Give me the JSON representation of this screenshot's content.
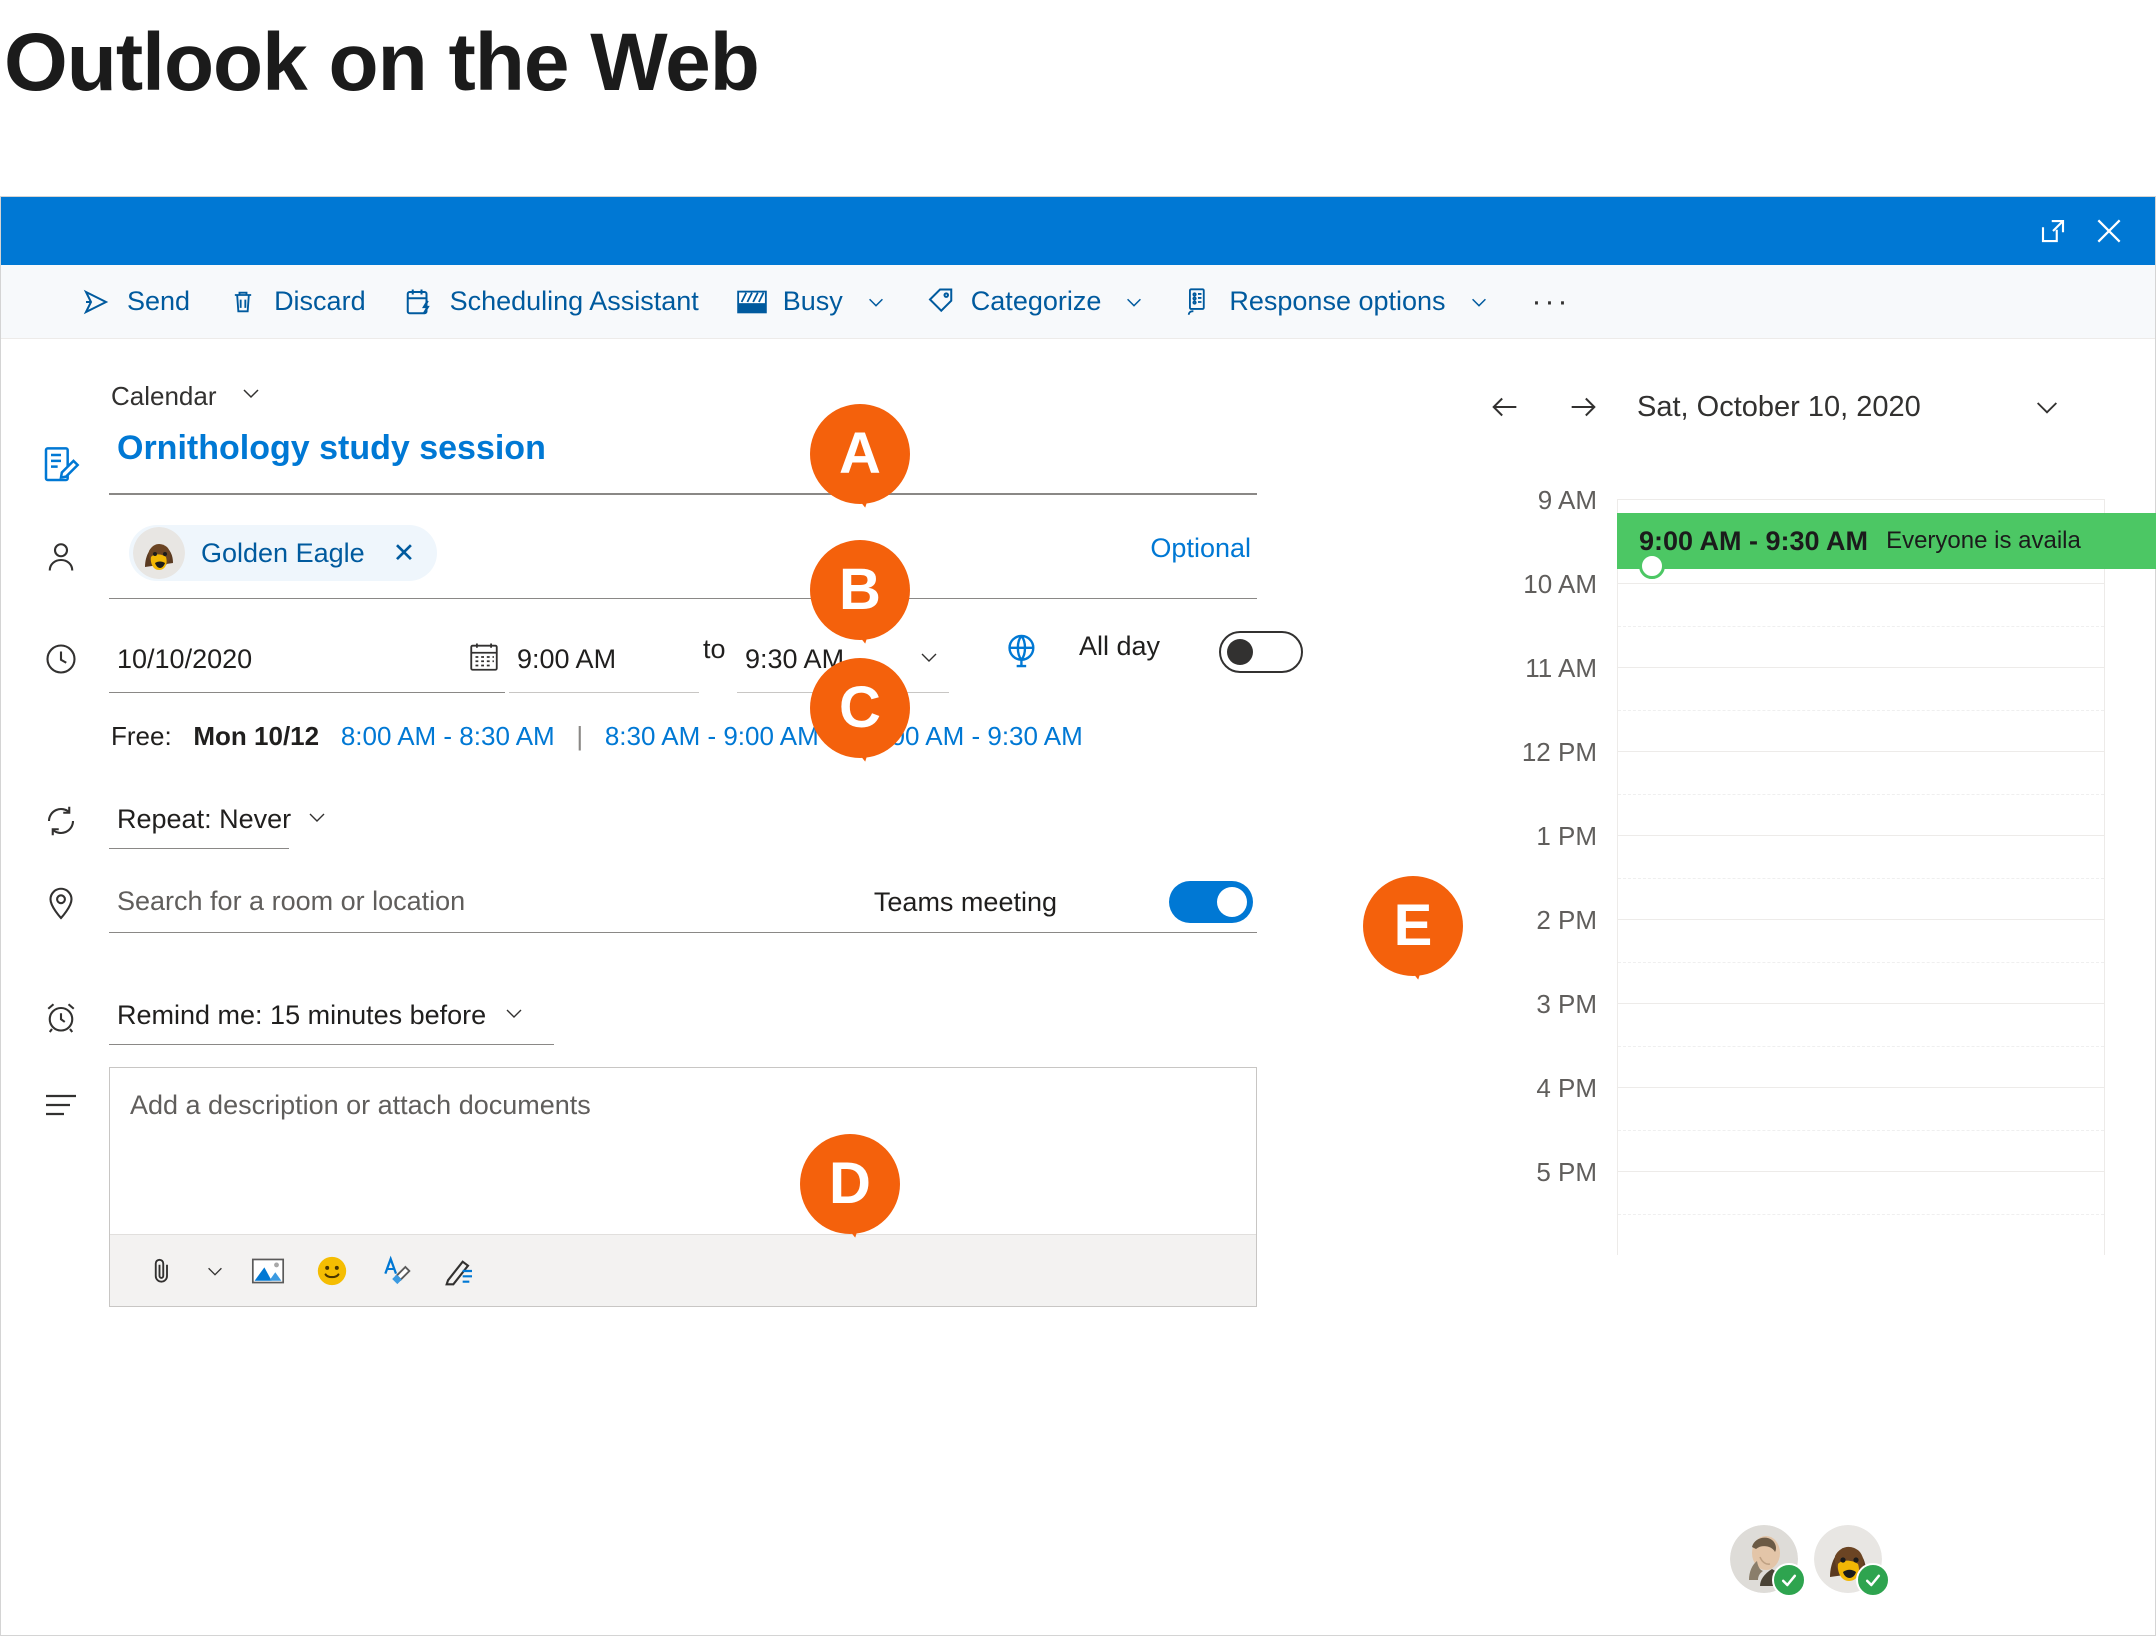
{
  "page": {
    "title": "Outlook on the Web"
  },
  "titlebar": {
    "popout_icon": "pop-out-icon",
    "close_icon": "close-icon"
  },
  "ribbon": {
    "items": [
      {
        "label": "Send",
        "icon": "send-icon",
        "caret": false
      },
      {
        "label": "Discard",
        "icon": "trash-icon",
        "caret": false
      },
      {
        "label": "Scheduling Assistant",
        "icon": "scheduling-assistant-icon",
        "caret": false
      },
      {
        "label": "Busy",
        "icon": "busy-icon",
        "caret": true
      },
      {
        "label": "Categorize",
        "icon": "tag-icon",
        "caret": true
      },
      {
        "label": "Response options",
        "icon": "response-options-icon",
        "caret": true
      }
    ],
    "overflow": "···"
  },
  "form": {
    "calendar_selector": "Calendar",
    "title_value": "Ornithology study session",
    "attendee": {
      "name": "Golden Eagle",
      "remove": "✕"
    },
    "optional_link": "Optional",
    "date_value": "10/10/2020",
    "start_time": "9:00 AM",
    "to_word": "to",
    "end_time": "9:30 AM",
    "all_day_label": "All day",
    "all_day_on": false,
    "free": {
      "label": "Free:",
      "day": "Mon 10/12",
      "slots": [
        "8:00 AM - 8:30 AM",
        "8:30 AM - 9:00 AM",
        "9:00 AM - 9:30 AM"
      ],
      "separator": "|"
    },
    "repeat": "Repeat:  Never",
    "location_placeholder": "Search for a room or location",
    "teams_label": "Teams meeting",
    "teams_on": true,
    "remind": "Remind me:  15 minutes before",
    "description_placeholder": "Add a description or attach documents",
    "description_tools": [
      "attach-icon",
      "insert-picture-icon",
      "emoji-icon",
      "font-color-icon",
      "signature-icon"
    ]
  },
  "calendar": {
    "date_header": "Sat, October 10, 2020",
    "back_icon": "arrow-left-icon",
    "forward_icon": "arrow-right-icon",
    "expand_icon": "chevron-down-icon",
    "hours": [
      "9 AM",
      "10 AM",
      "11 AM",
      "12 PM",
      "1 PM",
      "2 PM",
      "3 PM",
      "4 PM",
      "5 PM"
    ],
    "event": {
      "time": "9:00 AM - 9:30 AM",
      "note": "Everyone is availa",
      "color": "#4cc764"
    },
    "attendees": [
      {
        "name": "attendee-1",
        "status": "accepted"
      },
      {
        "name": "attendee-2",
        "status": "accepted"
      }
    ]
  },
  "callouts": [
    {
      "letter": "A",
      "target": "event-title"
    },
    {
      "letter": "B",
      "target": "attendees"
    },
    {
      "letter": "C",
      "target": "start-time"
    },
    {
      "letter": "D",
      "target": "description"
    },
    {
      "letter": "E",
      "target": "teams-meeting-toggle"
    }
  ],
  "colors": {
    "accent": "#0078d4",
    "callout": "#f4610c",
    "free_green": "#4cc764",
    "link": "#005a9e"
  }
}
